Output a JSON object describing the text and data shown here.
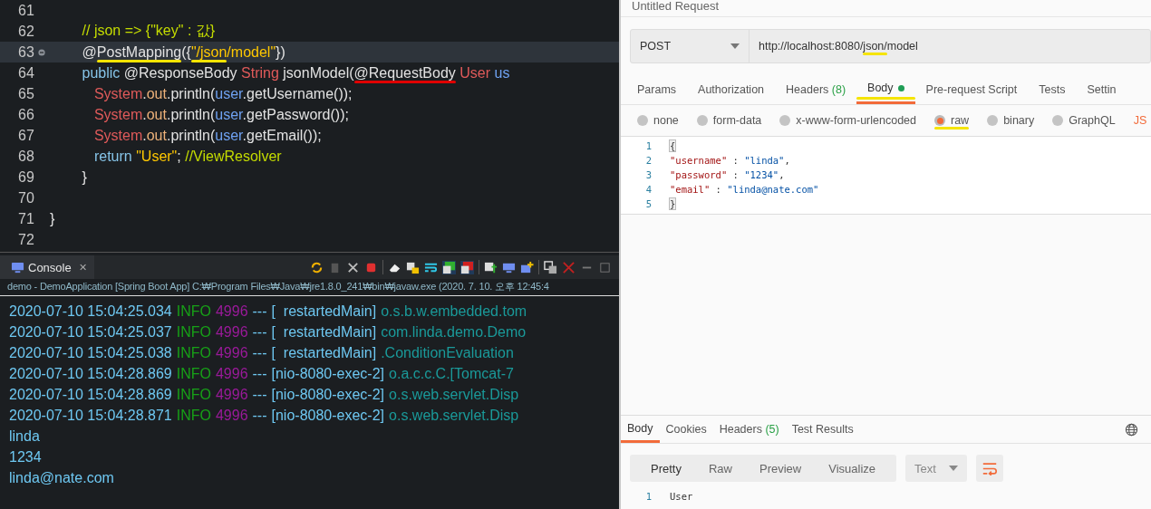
{
  "editor": {
    "lines": [
      {
        "number": "61",
        "selected": false,
        "fold": false
      },
      {
        "number": "62",
        "selected": false,
        "fold": false,
        "tokens": [
          {
            "text": "        // json => {\"key\" : 값}",
            "kind": "comment"
          }
        ]
      },
      {
        "number": "63",
        "selected": true,
        "fold": true,
        "tokens": [
          {
            "text": "        @",
            "kind": "plain"
          },
          {
            "text": "PostMapping",
            "kind": "plain",
            "color": "#f5e400"
          },
          {
            "text": "({",
            "kind": "plain"
          },
          {
            "text": "\"/json",
            "kind": "string",
            "color": "#f5e400"
          },
          {
            "text": "/model\"",
            "kind": "string"
          },
          {
            "text": "})",
            "kind": "plain"
          }
        ]
      },
      {
        "number": "64",
        "selected": false,
        "fold": false,
        "tokens": [
          {
            "text": "        public",
            "kind": "keyword"
          },
          {
            "text": " @ResponseBody ",
            "kind": "plain"
          },
          {
            "text": "String",
            "kind": "type"
          },
          {
            "text": " jsonModel(",
            "kind": "plain"
          },
          {
            "text": "@RequestBody",
            "kind": "plain",
            "color": "#e00000"
          },
          {
            "text": " User",
            "kind": "type"
          },
          {
            "text": " us",
            "kind": "var"
          }
        ]
      },
      {
        "number": "65",
        "selected": false,
        "fold": false,
        "tokens": [
          {
            "text": "           System",
            "kind": "type"
          },
          {
            "text": ".",
            "kind": "plain"
          },
          {
            "text": "out",
            "kind": "field"
          },
          {
            "text": ".println(",
            "kind": "plain"
          },
          {
            "text": "user",
            "kind": "var"
          },
          {
            "text": ".getUsername());",
            "kind": "plain"
          }
        ]
      },
      {
        "number": "66",
        "selected": false,
        "fold": false,
        "tokens": [
          {
            "text": "           System",
            "kind": "type"
          },
          {
            "text": ".",
            "kind": "plain"
          },
          {
            "text": "out",
            "kind": "field"
          },
          {
            "text": ".println(",
            "kind": "plain"
          },
          {
            "text": "user",
            "kind": "var"
          },
          {
            "text": ".getPassword());",
            "kind": "plain"
          }
        ]
      },
      {
        "number": "67",
        "selected": false,
        "fold": false,
        "tokens": [
          {
            "text": "           System",
            "kind": "type"
          },
          {
            "text": ".",
            "kind": "plain"
          },
          {
            "text": "out",
            "kind": "field"
          },
          {
            "text": ".println(",
            "kind": "plain"
          },
          {
            "text": "user",
            "kind": "var"
          },
          {
            "text": ".getEmail());",
            "kind": "plain"
          }
        ]
      },
      {
        "number": "68",
        "selected": false,
        "fold": false,
        "tokens": [
          {
            "text": "           return",
            "kind": "keyword"
          },
          {
            "text": " \"User\"",
            "kind": "string"
          },
          {
            "text": "; ",
            "kind": "plain"
          },
          {
            "text": "//ViewResolver",
            "kind": "comment"
          }
        ]
      },
      {
        "number": "69",
        "selected": false,
        "fold": false,
        "tokens": [
          {
            "text": "        }",
            "kind": "plain"
          }
        ]
      },
      {
        "number": "70",
        "selected": false,
        "fold": false
      },
      {
        "number": "71",
        "selected": false,
        "fold": false,
        "tokens": [
          {
            "text": "}",
            "kind": "plain"
          }
        ]
      },
      {
        "number": "72",
        "selected": false,
        "fold": false
      }
    ]
  },
  "console": {
    "tab": "Console",
    "close": "✕",
    "launch": "demo - DemoApplication [Spring Boot App] C:₩Program Files₩Java₩jre1.8.0_241₩bin₩javaw.exe (2020. 7. 10. 오후 12:45:4",
    "lines": [
      [
        {
          "text": "2020-07-10 15:04:25.034",
          "kind": "time"
        },
        {
          "text": "INFO",
          "kind": "level"
        },
        {
          "text": "4996",
          "kind": "pid"
        },
        {
          "text": "---",
          "kind": "time"
        },
        {
          "text": "[  restartedMain]",
          "kind": "time"
        },
        {
          "text": "o.s.b.w.embedded.tom",
          "kind": "logger"
        }
      ],
      [
        {
          "text": "2020-07-10 15:04:25.037",
          "kind": "time"
        },
        {
          "text": "INFO",
          "kind": "level"
        },
        {
          "text": "4996",
          "kind": "pid"
        },
        {
          "text": "---",
          "kind": "time"
        },
        {
          "text": "[  restartedMain]",
          "kind": "time"
        },
        {
          "text": "com.linda.demo.Demo",
          "kind": "logger"
        }
      ],
      [
        {
          "text": "2020-07-10 15:04:25.038",
          "kind": "time"
        },
        {
          "text": "INFO",
          "kind": "level"
        },
        {
          "text": "4996",
          "kind": "pid"
        },
        {
          "text": "---",
          "kind": "time"
        },
        {
          "text": "[  restartedMain]",
          "kind": "time"
        },
        {
          "text": ".ConditionEvaluation",
          "kind": "logger"
        }
      ],
      [
        {
          "text": "2020-07-10 15:04:28.869",
          "kind": "time"
        },
        {
          "text": "INFO",
          "kind": "level"
        },
        {
          "text": "4996",
          "kind": "pid"
        },
        {
          "text": "---",
          "kind": "time"
        },
        {
          "text": "[nio-8080-exec-2]",
          "kind": "time"
        },
        {
          "text": "o.a.c.c.C.[Tomcat-7",
          "kind": "logger"
        }
      ],
      [
        {
          "text": "2020-07-10 15:04:28.869",
          "kind": "time"
        },
        {
          "text": "INFO",
          "kind": "level"
        },
        {
          "text": "4996",
          "kind": "pid"
        },
        {
          "text": "---",
          "kind": "time"
        },
        {
          "text": "[nio-8080-exec-2]",
          "kind": "time"
        },
        {
          "text": "o.s.web.servlet.Disp",
          "kind": "logger"
        }
      ],
      [
        {
          "text": "2020-07-10 15:04:28.871",
          "kind": "time"
        },
        {
          "text": "INFO",
          "kind": "level"
        },
        {
          "text": "4996",
          "kind": "pid"
        },
        {
          "text": "---",
          "kind": "time"
        },
        {
          "text": "[nio-8080-exec-2]",
          "kind": "time"
        },
        {
          "text": "o.s.web.servlet.Disp",
          "kind": "logger"
        }
      ],
      [
        {
          "text": "linda",
          "kind": "time"
        }
      ],
      [
        {
          "text": "1234",
          "kind": "time"
        }
      ],
      [
        {
          "text": "linda@nate.com",
          "kind": "time"
        }
      ]
    ]
  },
  "request": {
    "title": "Untitled Request",
    "method": "POST",
    "url_parts": [
      {
        "text": "http://localhost:8080/"
      },
      {
        "text": "json/",
        "color": "#f5e400"
      },
      {
        "text": "model"
      }
    ],
    "tabs": [
      {
        "label": "Params",
        "selected": false
      },
      {
        "label": "Authorization",
        "selected": false
      },
      {
        "label": "Headers",
        "count": "(8)",
        "selected": false
      },
      {
        "label": "Body",
        "dot": true,
        "color": "#f5e400",
        "selected": true
      },
      {
        "label": "Pre-request Script",
        "selected": false
      },
      {
        "label": "Tests",
        "selected": false
      },
      {
        "label": "Settin",
        "selected": false
      }
    ],
    "body_types": [
      {
        "label": "none",
        "selected": false
      },
      {
        "label": "form-data",
        "selected": false
      },
      {
        "label": "x-www-form-urlencoded",
        "selected": false
      },
      {
        "label": "raw",
        "selected": true,
        "color": "#f5e400"
      },
      {
        "label": "binary",
        "selected": false
      },
      {
        "label": "GraphQL",
        "selected": false
      }
    ],
    "format": "JS",
    "body_lines": [
      {
        "number": "1",
        "tokens": [
          {
            "text": "{",
            "kind": "bracket"
          }
        ]
      },
      {
        "number": "2",
        "tokens": [
          {
            "text": "\"username\"",
            "kind": "key"
          },
          {
            "text": " : ",
            "kind": "punct"
          },
          {
            "text": "\"linda\"",
            "kind": "value"
          },
          {
            "text": ",",
            "kind": "punct"
          }
        ]
      },
      {
        "number": "3",
        "tokens": [
          {
            "text": "\"password\"",
            "kind": "key"
          },
          {
            "text": " : ",
            "kind": "punct"
          },
          {
            "text": "\"1234\"",
            "kind": "value"
          },
          {
            "text": ",",
            "kind": "punct"
          }
        ]
      },
      {
        "number": "4",
        "tokens": [
          {
            "text": "\"email\"",
            "kind": "key"
          },
          {
            "text": " : ",
            "kind": "punct"
          },
          {
            "text": "\"linda@nate.com\"",
            "kind": "value"
          }
        ]
      },
      {
        "number": "5",
        "tokens": [
          {
            "text": "}",
            "kind": "bracket"
          }
        ]
      }
    ]
  },
  "response": {
    "tabs": [
      {
        "label": "Body",
        "selected": true
      },
      {
        "label": "Cookies",
        "selected": false
      },
      {
        "label": "Headers",
        "count": "(5)",
        "selected": false
      },
      {
        "label": "Test Results",
        "selected": false
      }
    ],
    "views": [
      {
        "label": "Pretty",
        "selected": true
      },
      {
        "label": "Raw",
        "selected": false
      },
      {
        "label": "Preview",
        "selected": false
      },
      {
        "label": "Visualize",
        "selected": false
      }
    ],
    "type": "Text",
    "lines": [
      {
        "number": "1",
        "text": "User"
      }
    ]
  }
}
